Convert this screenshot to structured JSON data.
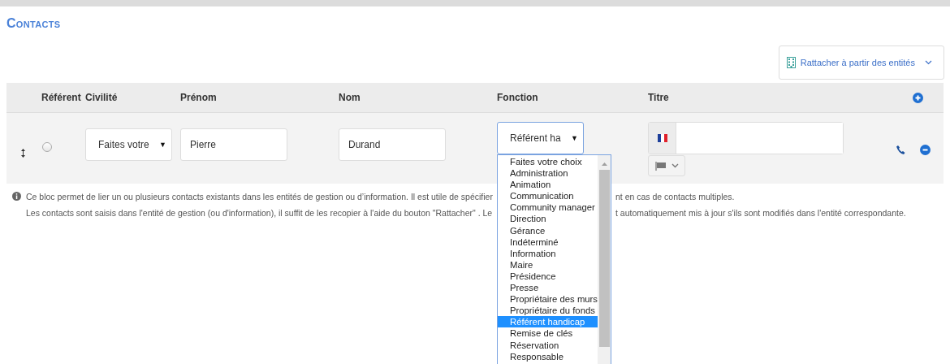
{
  "title": "Contacts",
  "attach_button": {
    "label": "Rattacher à partir des entités"
  },
  "table": {
    "columns": [
      "Référent",
      "Civilité",
      "Prénom",
      "Nom",
      "Fonction",
      "Titre"
    ],
    "rows": [
      {
        "referent": false,
        "civilite": "Faites votre",
        "civilite_arrow": "▼",
        "fonction_arrow": "▼",
        "prenom": "Pierre",
        "nom": "Durand",
        "fonction": "Référent ha",
        "titre": ""
      }
    ]
  },
  "fonction_dropdown": {
    "items": [
      {
        "label": "Faites votre choix",
        "selected": false
      },
      {
        "label": "Administration",
        "selected": false
      },
      {
        "label": "Animation",
        "selected": false
      },
      {
        "label": "Communication",
        "selected": false
      },
      {
        "label": "Community manager",
        "selected": false
      },
      {
        "label": "Direction",
        "selected": false
      },
      {
        "label": "Gérance",
        "selected": false
      },
      {
        "label": "Indéterminé",
        "selected": false
      },
      {
        "label": "Information",
        "selected": false
      },
      {
        "label": "Maire",
        "selected": false
      },
      {
        "label": "Présidence",
        "selected": false
      },
      {
        "label": "Presse",
        "selected": false
      },
      {
        "label": "Propriétaire des murs",
        "selected": false
      },
      {
        "label": "Propriétaire du fonds",
        "selected": false
      },
      {
        "label": "Référent handicap",
        "selected": true
      },
      {
        "label": "Remise de clés",
        "selected": false
      },
      {
        "label": "Réservation",
        "selected": false
      },
      {
        "label": "Responsable",
        "selected": false
      }
    ]
  },
  "info": [
    {
      "left": "Ce bloc permet de lier un ou plusieurs contacts existants dans les entités de gestion ou d’information. Il est utile de spécifier",
      "right": "nt en cas de contacts multiples."
    },
    {
      "left": "Les contacts sont saisis dans l'entité de gestion (ou d'information), il suffit de les recopier à l'aide du bouton \"Rattacher\" . Le",
      "right": "t automatiquement mis à jour s'ils sont modifiés dans l'entité correspondante."
    }
  ]
}
